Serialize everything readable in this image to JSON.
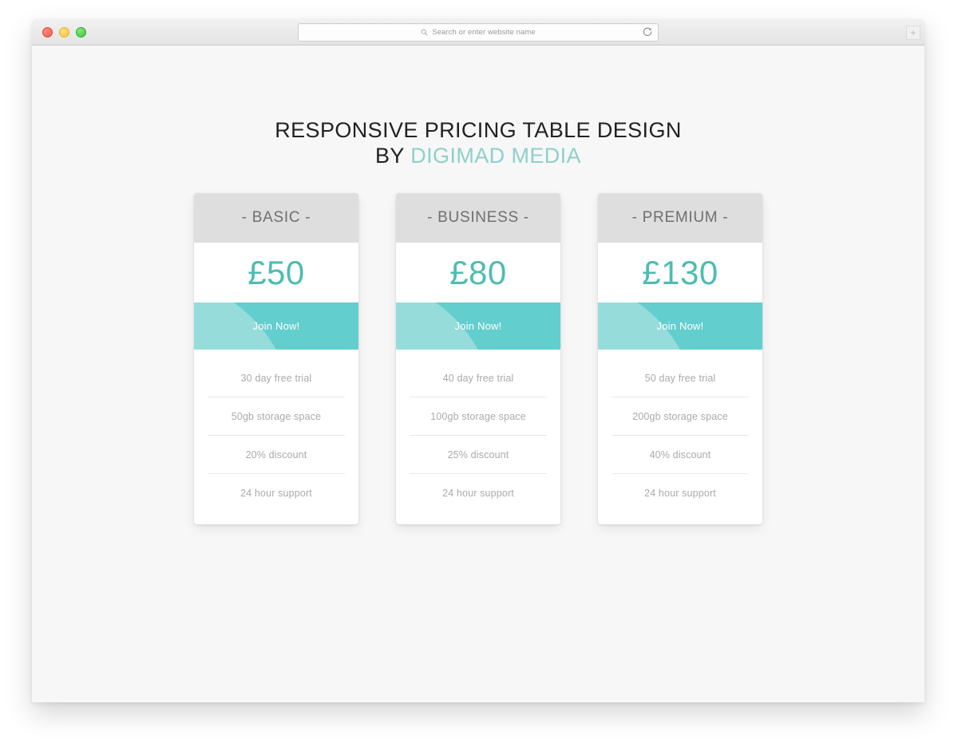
{
  "browser": {
    "traffic_lights": [
      "close",
      "minimize",
      "maximize"
    ],
    "address_placeholder": "Search or enter website name",
    "reload_icon": "reload-icon",
    "search_icon": "search-icon",
    "new_tab_label": "+"
  },
  "page": {
    "heading_line1": "RESPONSIVE PRICING TABLE DESIGN",
    "heading_by": "BY ",
    "heading_brand": "DIGIMAD MEDIA",
    "colors": {
      "background": "#f7f7f7",
      "brand_teal": "#8ed0cb",
      "price_teal": "#4dbdb0",
      "cta_teal": "#63cece",
      "cta_teal_light": "#96dcdb",
      "header_gray": "#dedede",
      "heading_dark": "#222222",
      "feature_gray": "#aaaaaa"
    }
  },
  "plans": [
    {
      "name": "- BASIC -",
      "price": "£50",
      "cta": "Join Now!",
      "features": [
        "30 day free trial",
        "50gb storage space",
        "20% discount",
        "24 hour support"
      ]
    },
    {
      "name": "- BUSINESS -",
      "price": "£80",
      "cta": "Join Now!",
      "features": [
        "40 day free trial",
        "100gb storage space",
        "25% discount",
        "24 hour support"
      ]
    },
    {
      "name": "- PREMIUM -",
      "price": "£130",
      "cta": "Join Now!",
      "features": [
        "50 day free trial",
        "200gb storage space",
        "40% discount",
        "24 hour support"
      ]
    }
  ]
}
